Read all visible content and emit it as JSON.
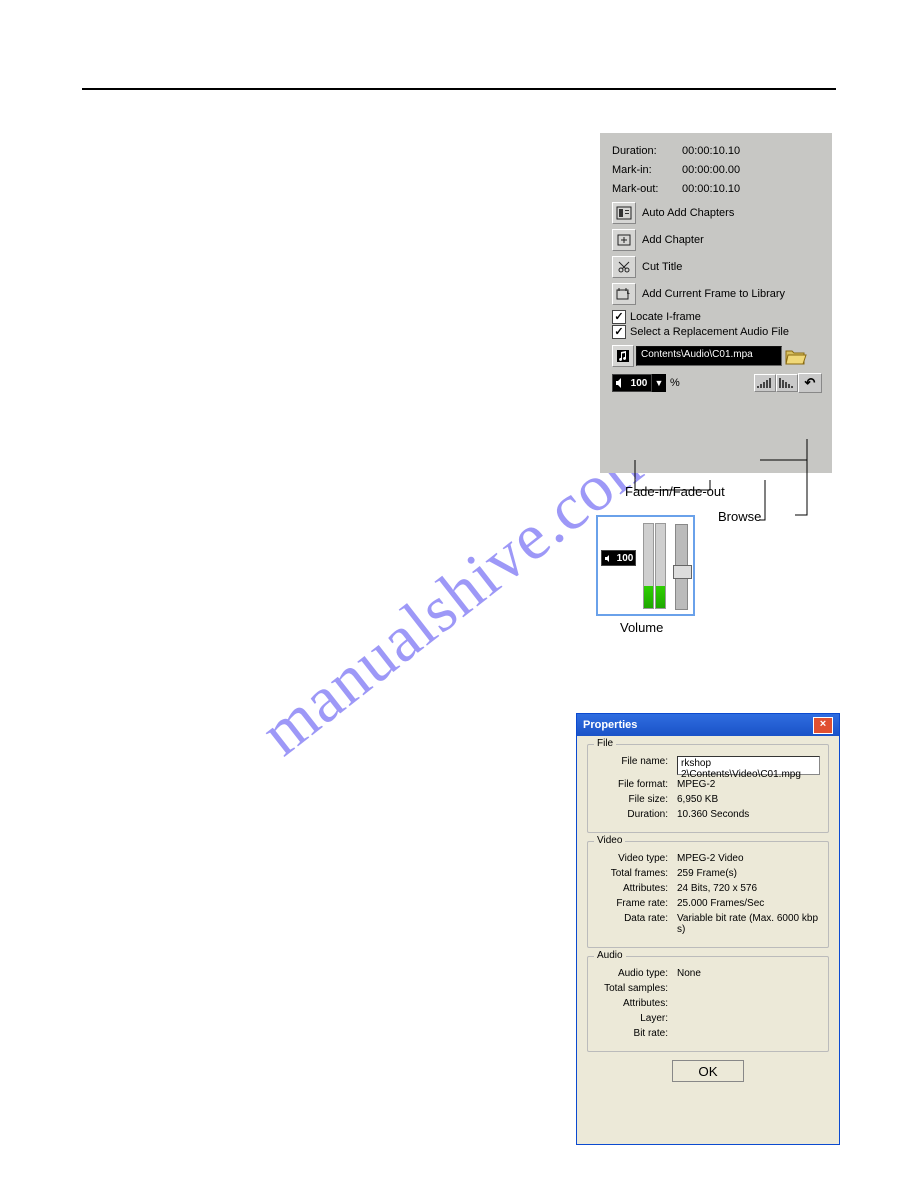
{
  "panel": {
    "duration_k": "Duration:",
    "duration_v": "00:00:10.10",
    "markin_k": "Mark-in:",
    "markin_v": "00:00:00.00",
    "markout_k": "Mark-out:",
    "markout_v": "00:00:10.10",
    "auto_add": "Auto Add Chapters",
    "add_chapter": "Add Chapter",
    "cut_title": "Cut Title",
    "add_frame": "Add Current Frame to Library",
    "locate": "Locate I-frame",
    "select_audio": "Select a Replacement Audio File",
    "audio_path": "Contents\\Audio\\C01.mpa",
    "vol": "100",
    "percent": "%"
  },
  "labels": {
    "fade": "Fade-in/Fade-out",
    "browse": "Browse",
    "volume": "Volume"
  },
  "dialog": {
    "title": "Properties",
    "file_grp": "File",
    "file_name_k": "File name:",
    "file_name_v": "rkshop 2\\Contents\\Video\\C01.mpg",
    "file_format_k": "File format:",
    "file_format_v": "MPEG-2",
    "file_size_k": "File size:",
    "file_size_v": "6,950 KB",
    "duration_k": "Duration:",
    "duration_v": "10.360 Seconds",
    "video_grp": "Video",
    "vtype_k": "Video type:",
    "vtype_v": "MPEG-2 Video",
    "frames_k": "Total frames:",
    "frames_v": "259 Frame(s)",
    "attr_k": "Attributes:",
    "attr_v": "24 Bits, 720 x 576",
    "frate_k": "Frame rate:",
    "frate_v": "25.000 Frames/Sec",
    "drate_k": "Data rate:",
    "drate_v": "Variable bit rate (Max. 6000 kbps)",
    "audio_grp": "Audio",
    "atype_k": "Audio type:",
    "atype_v": "None",
    "samples_k": "Total samples:",
    "samples_v": "",
    "aattr_k": "Attributes:",
    "aattr_v": "",
    "layer_k": "Layer:",
    "layer_v": "",
    "brate_k": "Bit rate:",
    "brate_v": "",
    "ok": "OK"
  },
  "popup": {
    "vol": "100"
  }
}
